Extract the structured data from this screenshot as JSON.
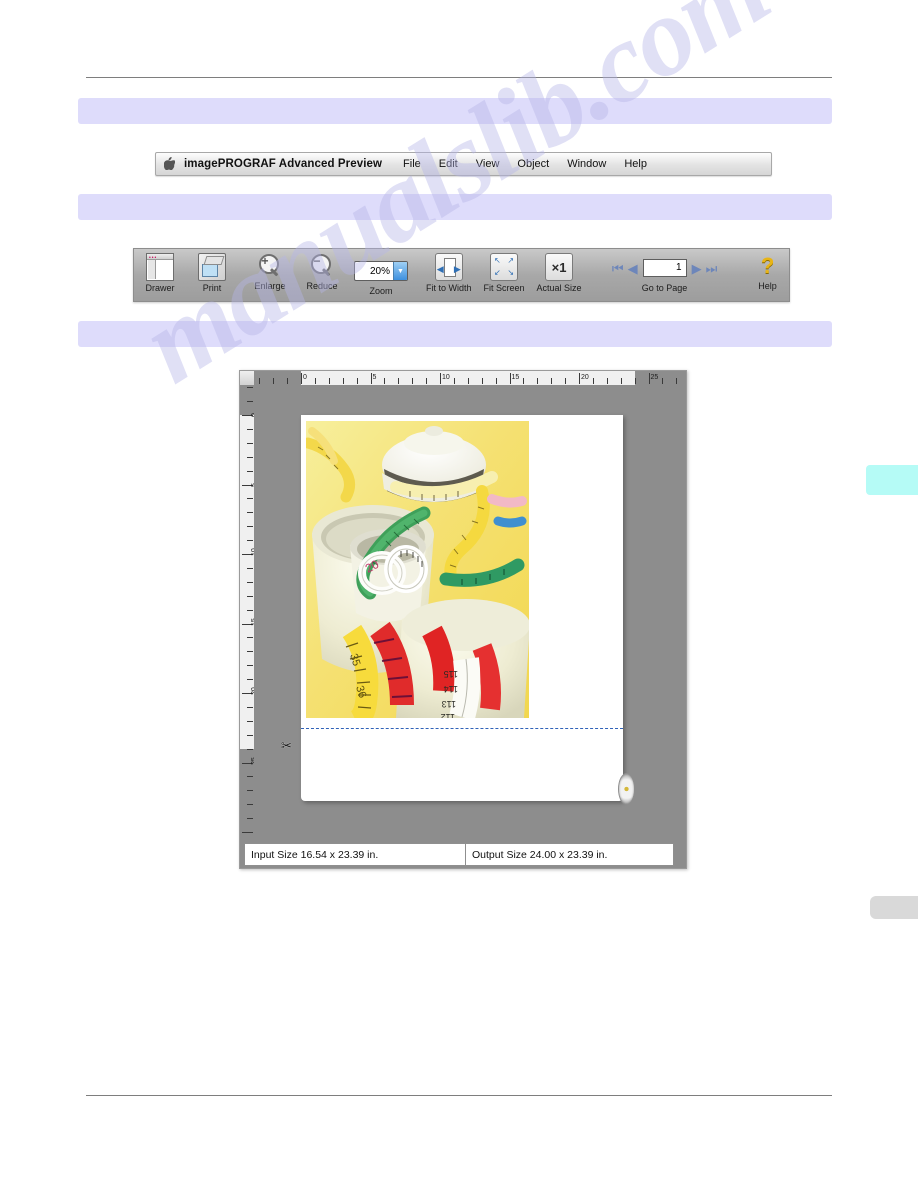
{
  "app": {
    "apple_glyph": "",
    "name": "imagePROGRAF Advanced Preview",
    "menus": [
      "File",
      "Edit",
      "View",
      "Object",
      "Window",
      "Help"
    ]
  },
  "toolbar": {
    "drawer_label": "Drawer",
    "print_label": "Print",
    "enlarge_label": "Enlarge",
    "enlarge_sign": "+",
    "reduce_label": "Reduce",
    "reduce_sign": "−",
    "zoom_label": "Zoom",
    "zoom_value": "20%",
    "zoom_arrow": "▼",
    "fit_width_label": "Fit to Width",
    "fit_width_arrow_left": "◀",
    "fit_width_arrow_right": "▶",
    "fit_screen_label": "Fit Screen",
    "fit_screen_tl": "↖",
    "fit_screen_tr": "↗",
    "fit_screen_bl": "↙",
    "fit_screen_br": "↘",
    "actual_size_label": "Actual Size",
    "actual_size_glyph": "×1",
    "goto_page_label": "Go to Page",
    "page_value": "1",
    "nav_first": "⏮",
    "nav_prev": "◀",
    "nav_next": "▶",
    "nav_last": "⏭",
    "help_label": "Help",
    "help_glyph": "?"
  },
  "preview": {
    "ruler_unit": "in",
    "ruler_h_ticks": [
      "0",
      "5",
      "10",
      "15",
      "20",
      "25"
    ],
    "ruler_v_ticks": [
      "0",
      "5",
      "10",
      "15",
      "20",
      "25"
    ],
    "scissors_glyph": "✂",
    "cut_line_color": "#2f62b8"
  },
  "status": {
    "input_size": "Input Size 16.54 x 23.39 in.",
    "output_size": "Output Size 24.00 x 23.39 in."
  },
  "watermark": {
    "text": "manualslib.com"
  },
  "colors": {
    "banner": "#dedcfb",
    "canvas_gray": "#8d8d8d",
    "accent_blue": "#3e90df",
    "help_yellow": "#e8b415",
    "tab_cyan": "#b5fbf6",
    "tab_gray": "#d9d9d9"
  }
}
